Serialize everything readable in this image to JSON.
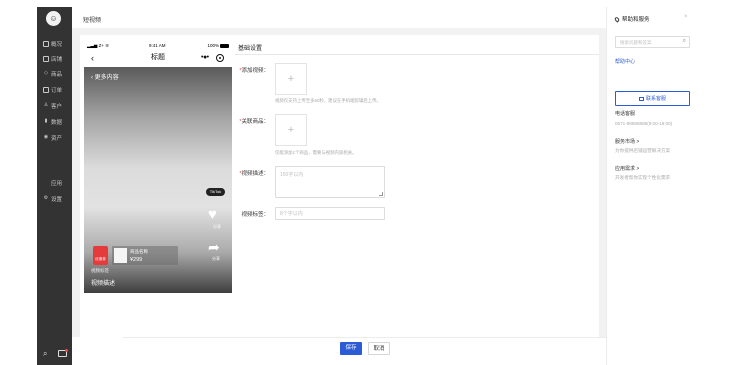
{
  "sidebar": {
    "logo_glyph": "☺",
    "items": [
      {
        "icon": "monitor-icon",
        "label": "概况"
      },
      {
        "icon": "store-icon",
        "label": "店铺"
      },
      {
        "icon": "tag-icon",
        "label": "商品"
      },
      {
        "icon": "order-icon",
        "label": "订单"
      },
      {
        "icon": "user-icon",
        "label": "客户"
      },
      {
        "icon": "chart-icon",
        "label": "数据"
      },
      {
        "icon": "asset-icon",
        "label": "资产"
      },
      {
        "icon": "apps-icon",
        "label": "应用"
      },
      {
        "icon": "gear-icon",
        "label": "设置"
      }
    ],
    "bottom": {
      "search_icon": "search-icon",
      "message_icon": "message-icon"
    }
  },
  "header": {
    "title": "短视频"
  },
  "preview": {
    "status": {
      "carrier": "Z+",
      "time": "9:41 AM",
      "battery": "100%"
    },
    "nav_title": "标题",
    "more_content": "更多内容",
    "badge": "TikTok",
    "like_label": "分享",
    "share_label": "分享",
    "promo_label": "优惠券",
    "product_name": "商品名称",
    "product_price": "¥299",
    "video_tag": "视频标签",
    "video_desc": "视频描述"
  },
  "form": {
    "section_title": "基础设置",
    "fields": {
      "video": {
        "label": "添加视频：",
        "required": true,
        "hint": "视频仅支持上传至多60秒，建议在手机端剪辑后上传。"
      },
      "product": {
        "label": "关联商品：",
        "required": true,
        "hint": "仅能添加1个商品，需要与视频内容相关。"
      },
      "desc": {
        "label": "视频描述：",
        "required": true,
        "placeholder": "150字以内"
      },
      "tag": {
        "label": "视频标签：",
        "required": false,
        "placeholder": "8个字以内"
      }
    }
  },
  "footer": {
    "save": "保存",
    "cancel": "取消"
  },
  "help": {
    "title": "帮助和服务",
    "close": "×",
    "search_placeholder": "搜索问题和答案",
    "help_center": "帮助中心",
    "contact": "联系客服",
    "items": [
      {
        "title": "电话客服",
        "sub": "0571-88888888(9:00-18:00)"
      },
      {
        "title": "服务市场 >",
        "sub": "为你提供店铺运营解决方案"
      },
      {
        "title": "应用需求 >",
        "sub": "开发者帮你实现个性化需求"
      }
    ]
  },
  "colors": {
    "accent": "#2b5cd6",
    "sidebar_bg": "#333333",
    "required": "#e64340"
  }
}
